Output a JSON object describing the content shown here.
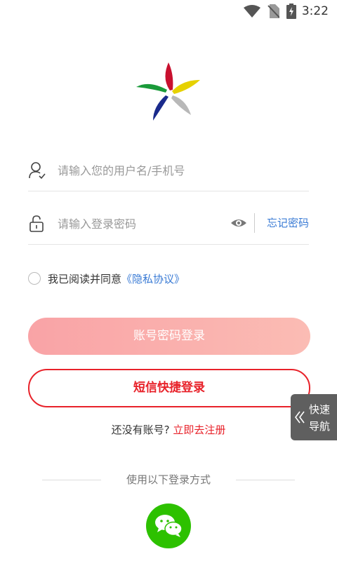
{
  "status_bar": {
    "time": "3:22"
  },
  "login": {
    "username_placeholder": "请输入您的用户名/手机号",
    "password_placeholder": "请输入登录密码",
    "forgot_password": "忘记密码",
    "agreement_prefix": "我已阅读并同意",
    "agreement_link": "《隐私协议》",
    "password_login_button": "账号密码登录",
    "sms_login_button": "短信快捷登录",
    "no_account_text": "还没有账号?",
    "register_link": "立即去注册",
    "other_methods": "使用以下登录方式"
  },
  "quick_nav": {
    "label_line1": "快速",
    "label_line2": "导航"
  },
  "colors": {
    "accent_red": "#e8222a",
    "link_blue": "#3a7bd5",
    "wechat_green": "#2dc100"
  },
  "icons": [
    "wifi-icon",
    "no-sim-icon",
    "battery-icon",
    "user-icon",
    "lock-icon",
    "eye-icon",
    "chevron-left-double-icon",
    "wechat-icon"
  ]
}
